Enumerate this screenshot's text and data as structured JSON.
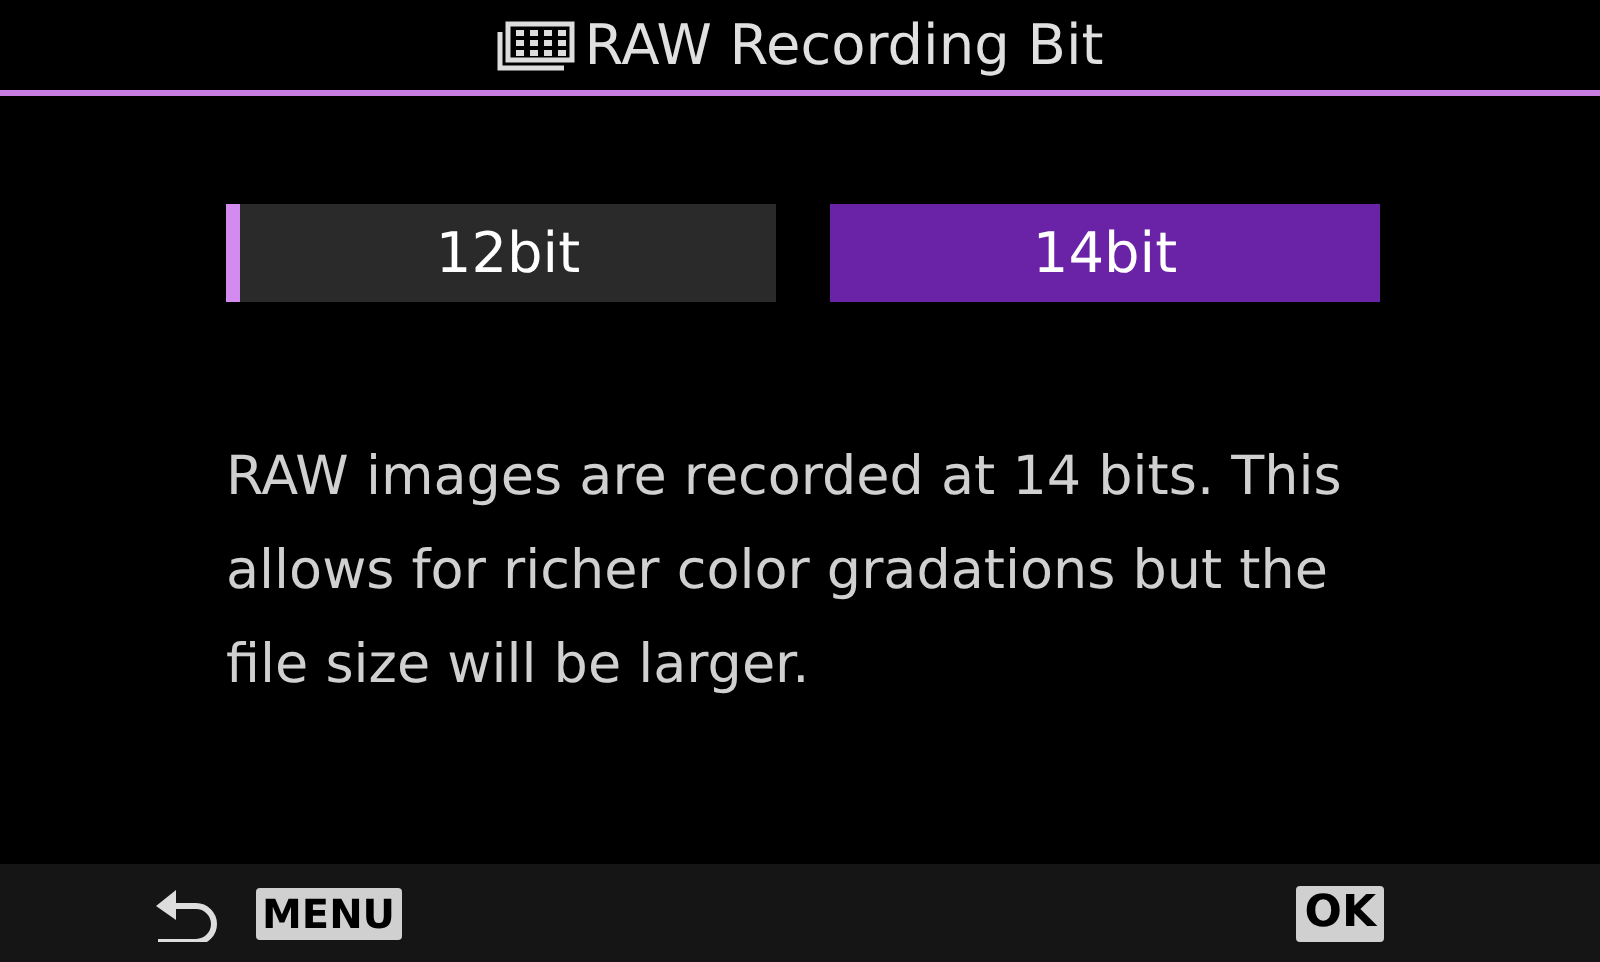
{
  "title": "RAW Recording Bit",
  "options": [
    {
      "label": "12bit",
      "selected": false,
      "focused": true
    },
    {
      "label": "14bit",
      "selected": true,
      "focused": false
    }
  ],
  "description": "RAW images are recorded at 14 bits. This allows for richer color gradations but the file size will be larger.",
  "footer": {
    "back_key": "MENU",
    "ok_key": "OK"
  }
}
